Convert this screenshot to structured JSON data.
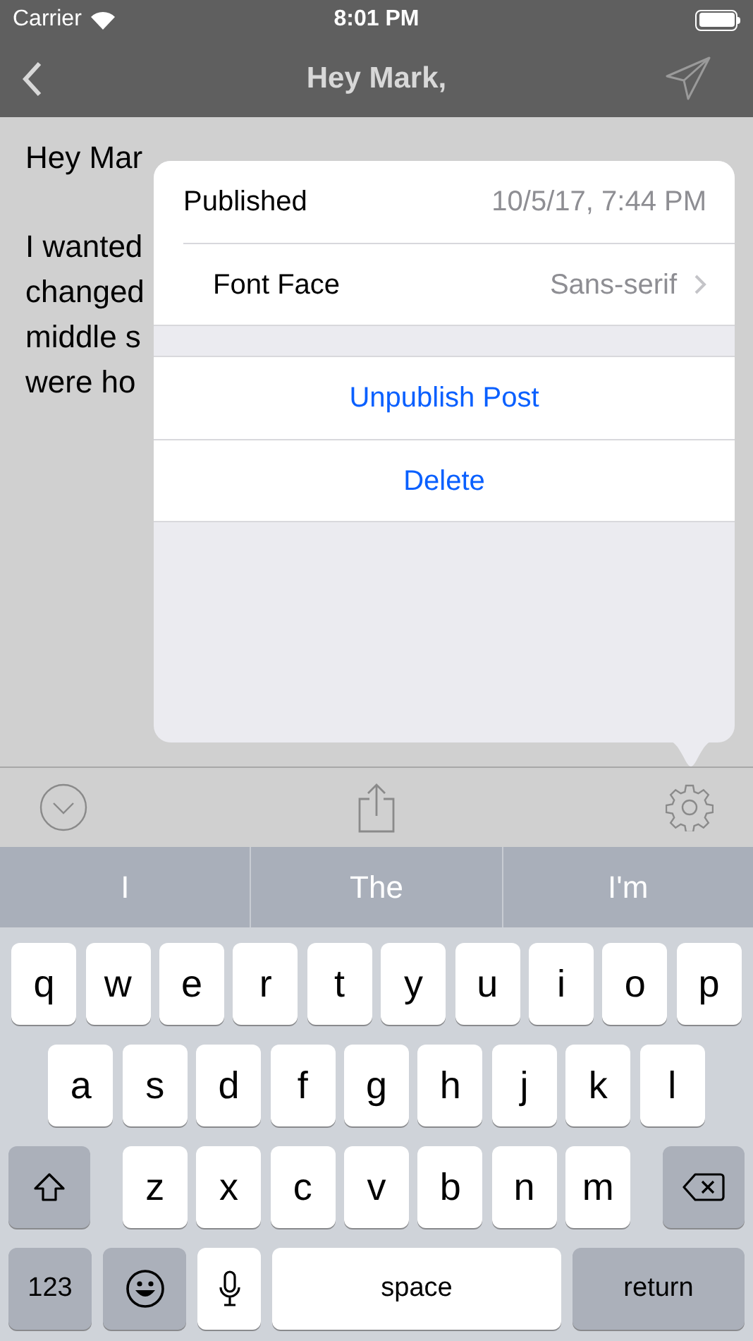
{
  "status_bar": {
    "carrier": "Carrier",
    "time": "8:01 PM"
  },
  "nav": {
    "title": "Hey Mark,"
  },
  "body": {
    "paragraphs": [
      {
        "lines": [
          "Hey Mar"
        ]
      },
      {
        "lines": [
          "I wanted",
          "changed",
          "middle s",
          "were ho"
        ]
      }
    ]
  },
  "popover": {
    "rows": [
      {
        "label": "Published",
        "value": "10/5/17, 7:44 PM",
        "chevron": false
      },
      {
        "label": "Font Face",
        "value": "Sans-serif",
        "chevron": true
      }
    ],
    "actions": [
      "Unpublish Post",
      "Delete"
    ]
  },
  "suggestions": [
    "I",
    "The",
    "I'm"
  ],
  "keyboard": {
    "row_1": [
      {
        "kind": "letter",
        "label": "q"
      },
      {
        "kind": "letter",
        "label": "w"
      },
      {
        "kind": "letter",
        "label": "e"
      },
      {
        "kind": "letter",
        "label": "r"
      },
      {
        "kind": "letter",
        "label": "t"
      },
      {
        "kind": "letter",
        "label": "y"
      },
      {
        "kind": "letter",
        "label": "u"
      },
      {
        "kind": "letter",
        "label": "i"
      },
      {
        "kind": "letter",
        "label": "o"
      },
      {
        "kind": "letter",
        "label": "p"
      }
    ],
    "row_2": [
      {
        "kind": "letter",
        "label": "a"
      },
      {
        "kind": "letter",
        "label": "s"
      },
      {
        "kind": "letter",
        "label": "d"
      },
      {
        "kind": "letter",
        "label": "f"
      },
      {
        "kind": "letter",
        "label": "g"
      },
      {
        "kind": "letter",
        "label": "h"
      },
      {
        "kind": "letter",
        "label": "j"
      },
      {
        "kind": "letter",
        "label": "k"
      },
      {
        "kind": "letter",
        "label": "l"
      }
    ],
    "row_3": [
      {
        "kind": "shift"
      },
      {
        "kind": "letter",
        "label": "z"
      },
      {
        "kind": "letter",
        "label": "x"
      },
      {
        "kind": "letter",
        "label": "c"
      },
      {
        "kind": "letter",
        "label": "v"
      },
      {
        "kind": "letter",
        "label": "b"
      },
      {
        "kind": "letter",
        "label": "n"
      },
      {
        "kind": "letter",
        "label": "m"
      },
      {
        "kind": "delete"
      }
    ],
    "bottom_row": [
      {
        "kind": "numbers",
        "label": "123"
      },
      {
        "kind": "emoji"
      },
      {
        "kind": "mic"
      },
      {
        "kind": "space",
        "label": "space"
      },
      {
        "kind": "return",
        "label": "return"
      }
    ]
  }
}
